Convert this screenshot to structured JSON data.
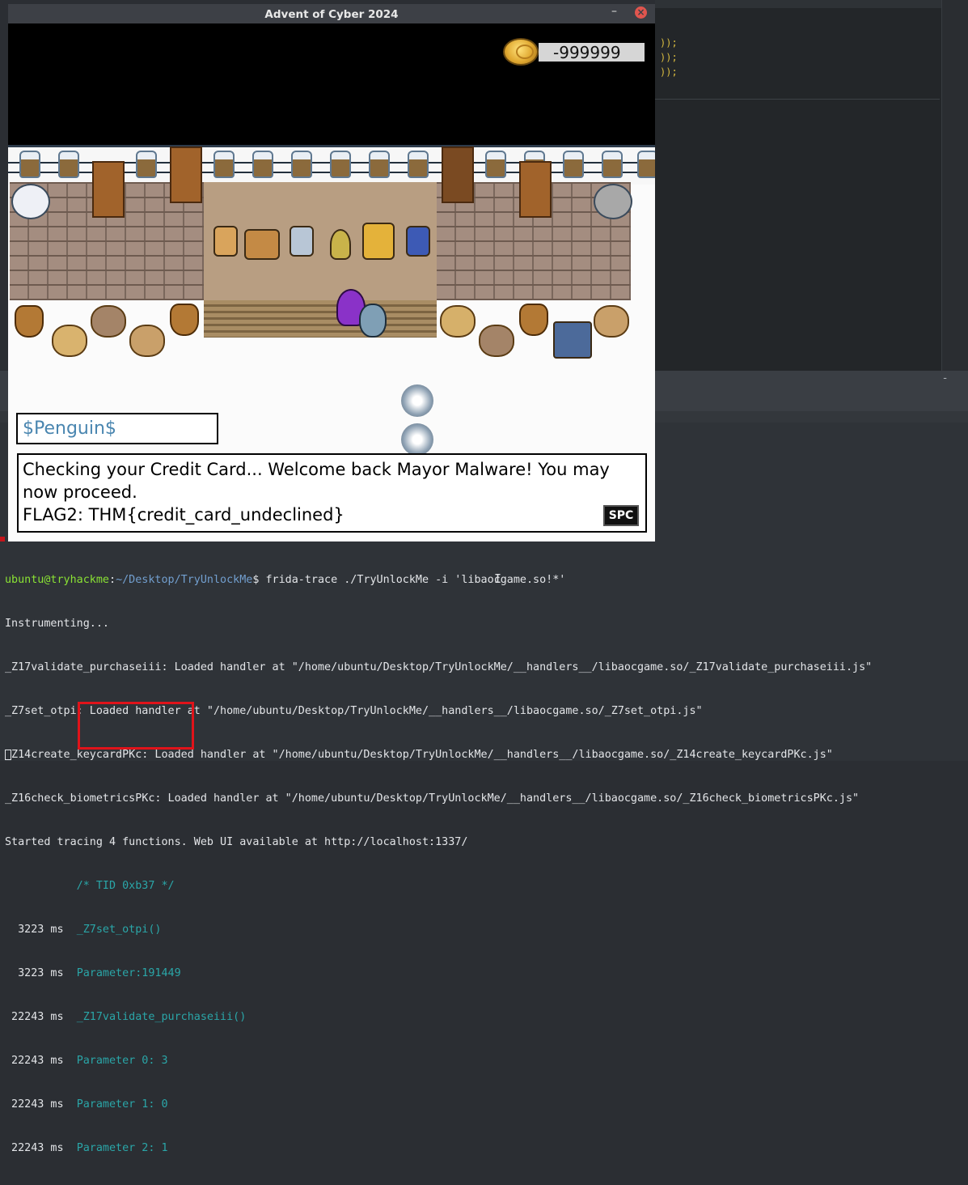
{
  "game": {
    "window_title": "Advent of Cyber 2024",
    "minimize": "–",
    "close": "×",
    "coin_value": "-999999",
    "npc_name": "$Penguin$",
    "dialog": {
      "line1": "Checking your Credit Card... Welcome back Mayor Malware! You may",
      "line2": "now proceed.",
      "line3": "FLAG2: THM{credit_card_undeclined}"
    },
    "continue_button": "SPC"
  },
  "editor": {
    "lines": [
      "));",
      "));",
      "));"
    ],
    "accent": "#d7ba3f"
  },
  "terminal": {
    "minimize": "-",
    "prompt_user": "ubuntu@tryhackme",
    "prompt_sep": ":",
    "prompt_path": "~/Desktop/TryUnlockMe",
    "prompt_symbol": "$ ",
    "command": "frida-trace ./TryUnlockMe -i 'libaocgame.so!*'",
    "instrumenting": "Instrumenting...",
    "handlers": [
      "_Z17validate_purchaseiii: Loaded handler at \"/home/ubuntu/Desktop/TryUnlockMe/__handlers__/libaocgame.so/_Z17validate_purchaseiii.js\"",
      "_Z7set_otpi: Loaded handler at \"/home/ubuntu/Desktop/TryUnlockMe/__handlers__/libaocgame.so/_Z7set_otpi.js\"",
      "_Z14create_keycardPKc: Loaded handler at \"/home/ubuntu/Desktop/TryUnlockMe/__handlers__/libaocgame.so/_Z14create_keycardPKc.js\"",
      "_Z16check_biometricsPKc: Loaded handler at \"/home/ubuntu/Desktop/TryUnlockMe/__handlers__/libaocgame.so/_Z16check_biometricsPKc.js\""
    ],
    "started": "Started tracing 4 functions. Web UI available at http://localhost:1337/",
    "tid": "           /* TID 0xb37 */",
    "trace": [
      {
        "ts": "  3223 ms  ",
        "msg": "_Z7set_otpi()"
      },
      {
        "ts": "  3223 ms  ",
        "msg": "Parameter:191449"
      },
      {
        "ts": " 22243 ms  ",
        "msg": "_Z17validate_purchaseiii()"
      },
      {
        "ts": " 22243 ms  ",
        "msg": "Parameter 0: 3"
      },
      {
        "ts": " 22243 ms  ",
        "msg": "Parameter 1: 0"
      },
      {
        "ts": " 22243 ms  ",
        "msg": "Parameter 2: 1"
      }
    ],
    "colors": {
      "user": "#8ae234",
      "path": "#729fcf",
      "trace": "#2aa6a8",
      "highlight": "#e0131a"
    }
  }
}
